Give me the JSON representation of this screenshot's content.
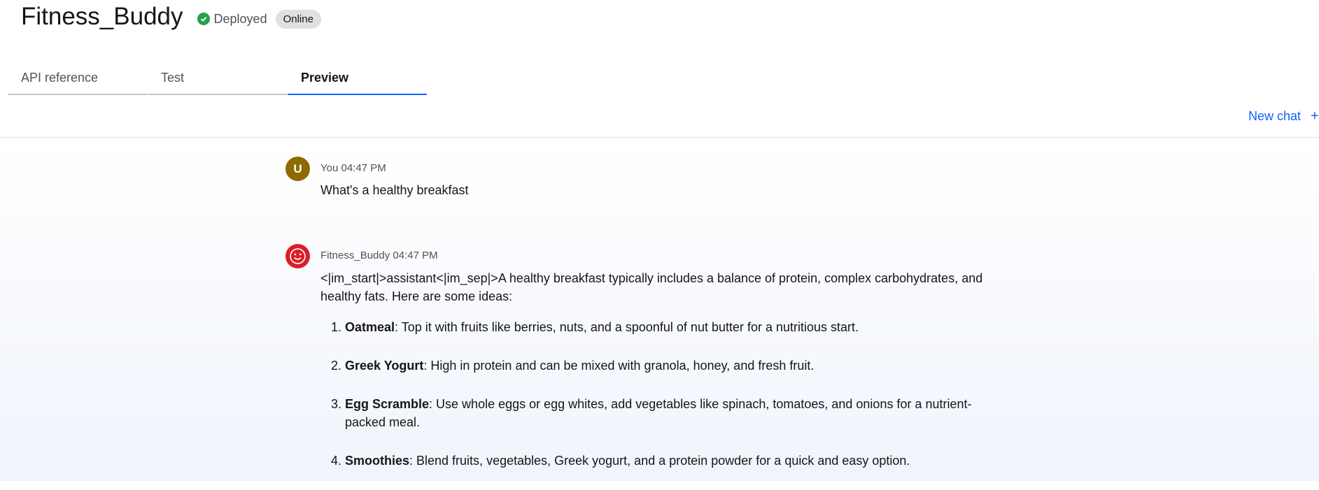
{
  "header": {
    "title": "Fitness_Buddy",
    "status": "Deployed",
    "badge": "Online"
  },
  "tabs": [
    {
      "label": "API reference",
      "active": false
    },
    {
      "label": "Test",
      "active": false
    },
    {
      "label": "Preview",
      "active": true
    }
  ],
  "new_chat": {
    "label": "New chat",
    "icon": "plus-icon"
  },
  "messages": {
    "user": {
      "avatar": "U",
      "sender": "You",
      "time": "04:47 PM",
      "text": "What's a healthy breakfast"
    },
    "bot": {
      "avatar_icon": "smiley-icon",
      "sender": "Fitness_Buddy",
      "time": "04:47 PM",
      "intro": "<|im_start|>assistant<|im_sep|>A healthy breakfast typically includes a balance of protein, complex carbohydrates, and healthy fats. Here are some ideas:",
      "items": [
        {
          "title": "Oatmeal",
          "text": ": Top it with fruits like berries, nuts, and a spoonful of nut butter for a nutritious start."
        },
        {
          "title": "Greek Yogurt",
          "text": ": High in protein and can be mixed with granola, honey, and fresh fruit."
        },
        {
          "title": "Egg Scramble",
          "text": ": Use whole eggs or egg whites, add vegetables like spinach, tomatoes, and onions for a nutrient-packed meal."
        },
        {
          "title": "Smoothies",
          "text": ": Blend fruits, vegetables, Greek yogurt, and a protein powder for a quick and easy option."
        }
      ]
    }
  },
  "colors": {
    "accent": "#0f62fe",
    "deployed": "#24a148",
    "user_avatar": "#8e6a00",
    "bot_avatar": "#da1e28"
  }
}
